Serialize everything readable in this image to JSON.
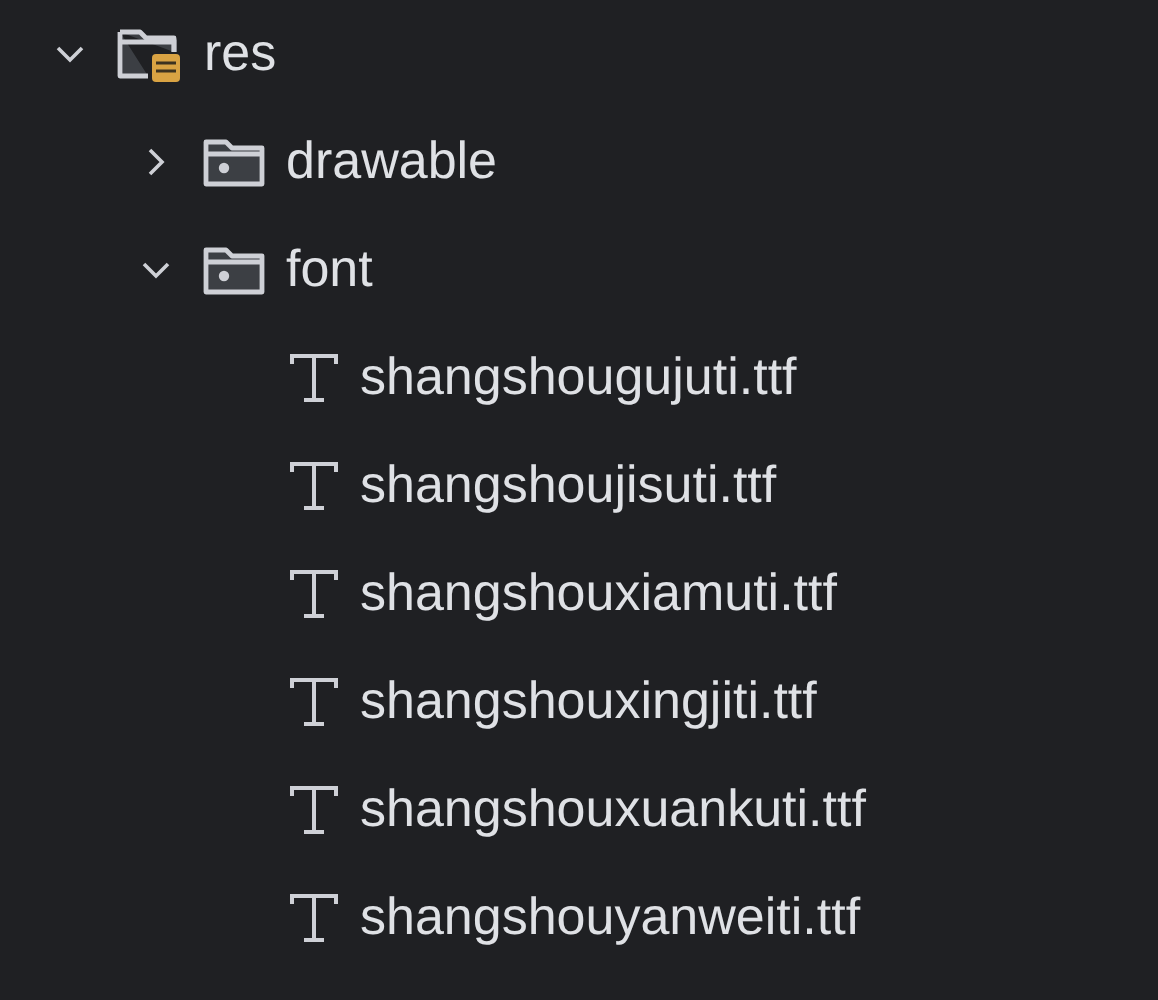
{
  "tree": [
    {
      "kind": "resources",
      "label": "res",
      "expanded": true,
      "children": [
        {
          "kind": "folder",
          "label": "drawable",
          "expanded": false
        },
        {
          "kind": "folder",
          "label": "font",
          "expanded": true,
          "children": [
            {
              "kind": "font",
              "label": "shangshougujuti.ttf"
            },
            {
              "kind": "font",
              "label": "shangshoujisuti.ttf"
            },
            {
              "kind": "font",
              "label": "shangshouxiamuti.ttf"
            },
            {
              "kind": "font",
              "label": "shangshouxingjiti.ttf"
            },
            {
              "kind": "font",
              "label": "shangshouxuankuti.ttf"
            },
            {
              "kind": "font",
              "label": "shangshouyanweiti.ttf"
            }
          ]
        }
      ]
    }
  ]
}
